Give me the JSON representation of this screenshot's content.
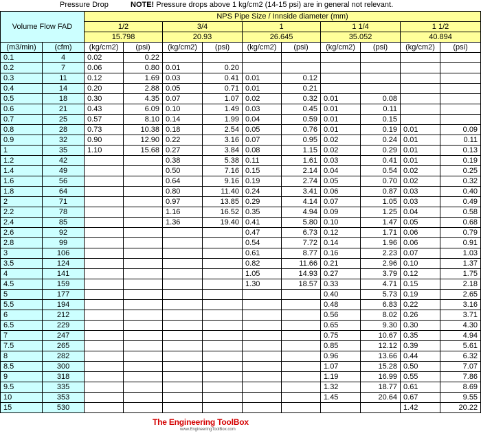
{
  "header": {
    "label": "Pressure Drop",
    "note_bold": "NOTE!",
    "note_text": " Pressure drops above 1 kg/cm2 (14-15 psi) are in general not relevant."
  },
  "table": {
    "volume_flow_label": "Volume Flow  FAD",
    "nps_label": "NPS Pipe Size / Innside diameter (mm)",
    "sizes": [
      "1/2",
      "3/4",
      "1",
      "1 1/4",
      "1 1/2"
    ],
    "diameters": [
      "15.798",
      "20.93",
      "26.645",
      "35.052",
      "40.894"
    ],
    "unit_m3": "(m3/min)",
    "unit_cfm": "(cfm)",
    "unit_kg": "(kg/cm2)",
    "unit_psi": "(psi)",
    "rows": [
      [
        "0.1",
        "4",
        "0.02",
        "0.22",
        "",
        "",
        "",
        "",
        "",
        "",
        "",
        ""
      ],
      [
        "0.2",
        "7",
        "0.06",
        "0.80",
        "0.01",
        "0.20",
        "",
        "",
        "",
        "",
        "",
        ""
      ],
      [
        "0.3",
        "11",
        "0.12",
        "1.69",
        "0.03",
        "0.41",
        "0.01",
        "0.12",
        "",
        "",
        "",
        ""
      ],
      [
        "0.4",
        "14",
        "0.20",
        "2.88",
        "0.05",
        "0.71",
        "0.01",
        "0.21",
        "",
        "",
        "",
        ""
      ],
      [
        "0.5",
        "18",
        "0.30",
        "4.35",
        "0.07",
        "1.07",
        "0.02",
        "0.32",
        "0.01",
        "0.08",
        "",
        ""
      ],
      [
        "0.6",
        "21",
        "0.43",
        "6.09",
        "0.10",
        "1.49",
        "0.03",
        "0.45",
        "0.01",
        "0.11",
        "",
        ""
      ],
      [
        "0.7",
        "25",
        "0.57",
        "8.10",
        "0.14",
        "1.99",
        "0.04",
        "0.59",
        "0.01",
        "0.15",
        "",
        ""
      ],
      [
        "0.8",
        "28",
        "0.73",
        "10.38",
        "0.18",
        "2.54",
        "0.05",
        "0.76",
        "0.01",
        "0.19",
        "0.01",
        "0.09"
      ],
      [
        "0.9",
        "32",
        "0.90",
        "12.90",
        "0.22",
        "3.16",
        "0.07",
        "0.95",
        "0.02",
        "0.24",
        "0.01",
        "0.11"
      ],
      [
        "1",
        "35",
        "1.10",
        "15.68",
        "0.27",
        "3.84",
        "0.08",
        "1.15",
        "0.02",
        "0.29",
        "0.01",
        "0.13"
      ],
      [
        "1.2",
        "42",
        "",
        "",
        "0.38",
        "5.38",
        "0.11",
        "1.61",
        "0.03",
        "0.41",
        "0.01",
        "0.19"
      ],
      [
        "1.4",
        "49",
        "",
        "",
        "0.50",
        "7.16",
        "0.15",
        "2.14",
        "0.04",
        "0.54",
        "0.02",
        "0.25"
      ],
      [
        "1.6",
        "56",
        "",
        "",
        "0.64",
        "9.16",
        "0.19",
        "2.74",
        "0.05",
        "0.70",
        "0.02",
        "0.32"
      ],
      [
        "1.8",
        "64",
        "",
        "",
        "0.80",
        "11.40",
        "0.24",
        "3.41",
        "0.06",
        "0.87",
        "0.03",
        "0.40"
      ],
      [
        "2",
        "71",
        "",
        "",
        "0.97",
        "13.85",
        "0.29",
        "4.14",
        "0.07",
        "1.05",
        "0.03",
        "0.49"
      ],
      [
        "2.2",
        "78",
        "",
        "",
        "1.16",
        "16.52",
        "0.35",
        "4.94",
        "0.09",
        "1.25",
        "0.04",
        "0.58"
      ],
      [
        "2.4",
        "85",
        "",
        "",
        "1.36",
        "19.40",
        "0.41",
        "5.80",
        "0.10",
        "1.47",
        "0.05",
        "0.68"
      ],
      [
        "2.6",
        "92",
        "",
        "",
        "",
        "",
        "0.47",
        "6.73",
        "0.12",
        "1.71",
        "0.06",
        "0.79"
      ],
      [
        "2.8",
        "99",
        "",
        "",
        "",
        "",
        "0.54",
        "7.72",
        "0.14",
        "1.96",
        "0.06",
        "0.91"
      ],
      [
        "3",
        "106",
        "",
        "",
        "",
        "",
        "0.61",
        "8.77",
        "0.16",
        "2.23",
        "0.07",
        "1.03"
      ],
      [
        "3.5",
        "124",
        "",
        "",
        "",
        "",
        "0.82",
        "11.66",
        "0.21",
        "2.96",
        "0.10",
        "1.37"
      ],
      [
        "4",
        "141",
        "",
        "",
        "",
        "",
        "1.05",
        "14.93",
        "0.27",
        "3.79",
        "0.12",
        "1.75"
      ],
      [
        "4.5",
        "159",
        "",
        "",
        "",
        "",
        "1.30",
        "18.57",
        "0.33",
        "4.71",
        "0.15",
        "2.18"
      ],
      [
        "5",
        "177",
        "",
        "",
        "",
        "",
        "",
        "",
        "0.40",
        "5.73",
        "0.19",
        "2.65"
      ],
      [
        "5.5",
        "194",
        "",
        "",
        "",
        "",
        "",
        "",
        "0.48",
        "6.83",
        "0.22",
        "3.16"
      ],
      [
        "6",
        "212",
        "",
        "",
        "",
        "",
        "",
        "",
        "0.56",
        "8.02",
        "0.26",
        "3.71"
      ],
      [
        "6.5",
        "229",
        "",
        "",
        "",
        "",
        "",
        "",
        "0.65",
        "9.30",
        "0.30",
        "4.30"
      ],
      [
        "7",
        "247",
        "",
        "",
        "",
        "",
        "",
        "",
        "0.75",
        "10.67",
        "0.35",
        "4.94"
      ],
      [
        "7.5",
        "265",
        "",
        "",
        "",
        "",
        "",
        "",
        "0.85",
        "12.12",
        "0.39",
        "5.61"
      ],
      [
        "8",
        "282",
        "",
        "",
        "",
        "",
        "",
        "",
        "0.96",
        "13.66",
        "0.44",
        "6.32"
      ],
      [
        "8.5",
        "300",
        "",
        "",
        "",
        "",
        "",
        "",
        "1.07",
        "15.28",
        "0.50",
        "7.07"
      ],
      [
        "9",
        "318",
        "",
        "",
        "",
        "",
        "",
        "",
        "1.19",
        "16.99",
        "0.55",
        "7.86"
      ],
      [
        "9.5",
        "335",
        "",
        "",
        "",
        "",
        "",
        "",
        "1.32",
        "18.77",
        "0.61",
        "8.69"
      ],
      [
        "10",
        "353",
        "",
        "",
        "",
        "",
        "",
        "",
        "1.45",
        "20.64",
        "0.67",
        "9.55"
      ],
      [
        "15",
        "530",
        "",
        "",
        "",
        "",
        "",
        "",
        "",
        "",
        "1.42",
        "20.22"
      ]
    ]
  },
  "logo": {
    "name": "The Engineering ToolBox",
    "url": "www.EngineeringToolBox.com"
  }
}
